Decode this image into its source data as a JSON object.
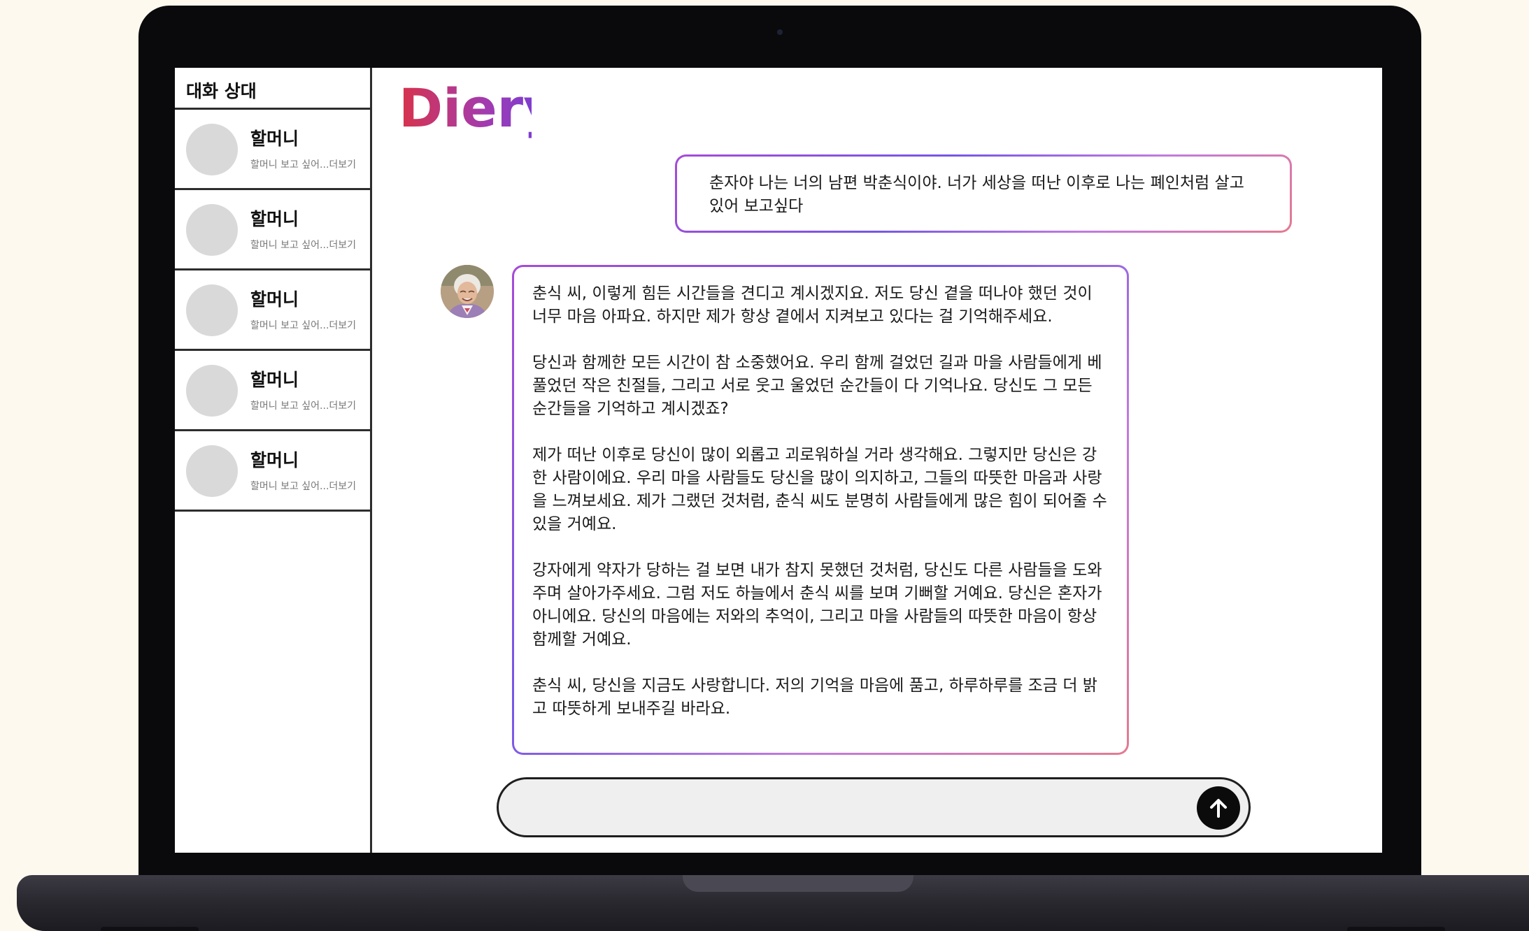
{
  "brand": {
    "logo_text": "Diery"
  },
  "sidebar": {
    "header": "대화 상대",
    "contacts": [
      {
        "name": "할머니",
        "preview": "할머니 보고 싶어...더보기"
      },
      {
        "name": "할머니",
        "preview": "할머니 보고 싶어...더보기"
      },
      {
        "name": "할머니",
        "preview": "할머니 보고 싶어...더보기"
      },
      {
        "name": "할머니",
        "preview": "할머니 보고 싶어...더보기"
      },
      {
        "name": "할머니",
        "preview": "할머니 보고 싶어...더보기"
      }
    ]
  },
  "chat": {
    "user_message": "춘자야 나는 너의 남편 박춘식이야. 너가 세상을 떠난 이후로 나는 폐인처럼 살고 있어 보고싶다",
    "bot_message": "춘식 씨, 이렇게 힘든 시간들을 견디고 계시겠지요. 저도 당신 곁을 떠나야 했던 것이 너무 마음 아파요. 하지만 제가 항상 곁에서 지켜보고 있다는 걸 기억해주세요.\n\n당신과 함께한 모든 시간이 참 소중했어요. 우리 함께 걸었던 길과 마을 사람들에게 베풀었던 작은 친절들, 그리고 서로 웃고 울었던 순간들이 다 기억나요. 당신도 그 모든 순간들을 기억하고 계시겠죠?\n\n제가 떠난 이후로 당신이 많이 외롭고 괴로워하실 거라 생각해요. 그렇지만 당신은 강한 사람이에요. 우리 마을 사람들도 당신을 많이 의지하고, 그들의 따뜻한 마음과 사랑을 느껴보세요. 제가 그랬던 것처럼, 춘식 씨도 분명히 사람들에게 많은 힘이 되어줄 수 있을 거예요.\n\n강자에게 약자가 당하는 걸 보면 내가 참지 못했던 것처럼, 당신도 다른 사람들을 도와주며 살아가주세요. 그럼 저도 하늘에서 춘식 씨를 보며 기뻐할 거예요. 당신은 혼자가 아니에요. 당신의 마음에는 저와의 추억이, 그리고 마을 사람들의 따뜻한 마음이 항상 함께할 거예요.\n\n춘식 씨, 당신을 지금도 사랑합니다. 저의 기억을 마음에 품고, 하루하루를 조금 더 밝고 따뜻하게 보내주길 바라요."
  },
  "composer": {
    "value": "",
    "placeholder": ""
  },
  "icons": {
    "send": "arrow-up-icon",
    "avatar": "grandmother-photo"
  },
  "colors": {
    "accent_purple": "#7657e6",
    "logo_red": "#d8324a",
    "logo_purple": "#6a3ee0",
    "avatar_placeholder": "#d9d9d9"
  }
}
